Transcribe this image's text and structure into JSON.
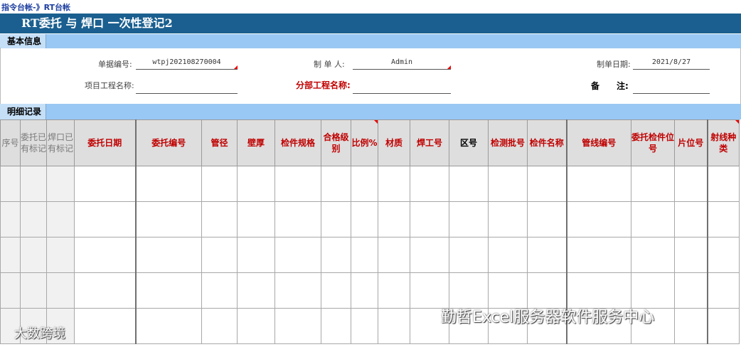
{
  "breadcrumb": {
    "root": "指令台帐",
    "sep": "-》",
    "current": "RT台帐"
  },
  "title": "RT委托 与 焊口 一次性登记2",
  "basic_section": {
    "label": "基本信息"
  },
  "form": {
    "doc_no_label": "单据编号:",
    "doc_no_value": "wtpj202108270004",
    "creator_label": "制 单 人:",
    "creator_value": "Admin",
    "date_label": "制单日期:",
    "date_value": "2021/8/27",
    "project_label": "项目工程名称:",
    "project_value": "",
    "subproject_label": "分部工程名称:",
    "subproject_value": "",
    "remark_label": "备　　注:",
    "remark_value": ""
  },
  "detail_section": {
    "label": "明细记录"
  },
  "table": {
    "headers": [
      "序号",
      "委托已有标记",
      "焊口已有标记",
      "委托日期",
      "委托编号",
      "管径",
      "壁厚",
      "检件规格",
      "合格级别",
      "比例%",
      "材质",
      "焊工号",
      "区号",
      "检测批号",
      "检件名称",
      "管线编号",
      "委托检件位号",
      "片位号",
      "射线种类"
    ],
    "row_count": 5
  },
  "watermarks": {
    "right": "勤哲Excel服务器软件服务中心",
    "left": "大数跨境"
  }
}
